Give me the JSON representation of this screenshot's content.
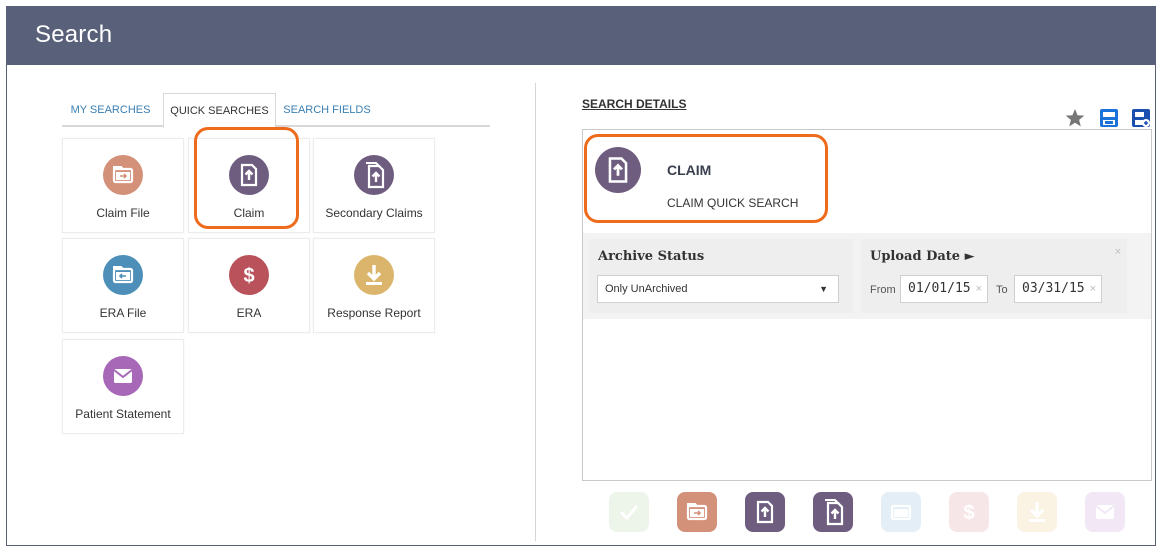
{
  "window": {
    "title": "Search"
  },
  "tabs": [
    {
      "label": "MY SEARCHES",
      "active": false
    },
    {
      "label": "QUICK SEARCHES",
      "active": true
    },
    {
      "label": "SEARCH FIELDS",
      "active": false
    }
  ],
  "tiles": [
    {
      "label": "Claim File",
      "icon": "claim-file-icon",
      "color": "#d4917a"
    },
    {
      "label": "Claim",
      "icon": "claim-icon",
      "color": "#6f5d80",
      "highlighted": true
    },
    {
      "label": "Secondary Claims",
      "icon": "secondary-claims-icon",
      "color": "#6f5d80"
    },
    {
      "label": "ERA File",
      "icon": "era-file-icon",
      "color": "#4d8fb8"
    },
    {
      "label": "ERA",
      "icon": "dollar-icon",
      "color": "#b9525a"
    },
    {
      "label": "Response Report",
      "icon": "download-icon",
      "color": "#dcb56c"
    },
    {
      "label": "Patient Statement",
      "icon": "envelope-icon",
      "color": "#a868b8"
    }
  ],
  "details": {
    "label": "SEARCH DETAILS",
    "claim_title": "CLAIM",
    "claim_subtitle": "CLAIM QUICK SEARCH",
    "tools": [
      "star-icon",
      "save-icon",
      "save-as-icon"
    ]
  },
  "filters": {
    "archive": {
      "title": "Archive Status",
      "value": "Only UnArchived"
    },
    "upload": {
      "title": "Upload Date ►",
      "from_label": "From",
      "from_value": "01/01/15",
      "to_label": "To",
      "to_value": "03/31/15"
    }
  },
  "strip": [
    {
      "icon": "check-icon",
      "color": "#edf4ea"
    },
    {
      "icon": "claim-file-icon",
      "color": "#d4917a"
    },
    {
      "icon": "claim-icon",
      "color": "#6f5d80"
    },
    {
      "icon": "secondary-claims-icon",
      "color": "#6f5d80"
    },
    {
      "icon": "era-file-icon",
      "color": "#e3eef6"
    },
    {
      "icon": "dollar-icon",
      "color": "#f6e6e7"
    },
    {
      "icon": "download-icon",
      "color": "#faf2e2"
    },
    {
      "icon": "envelope-icon",
      "color": "#f2e7f5"
    }
  ],
  "colors": {
    "titlebar": "#596079",
    "highlight": "#ee6b1b",
    "tab_link": "#3a7fb3"
  }
}
